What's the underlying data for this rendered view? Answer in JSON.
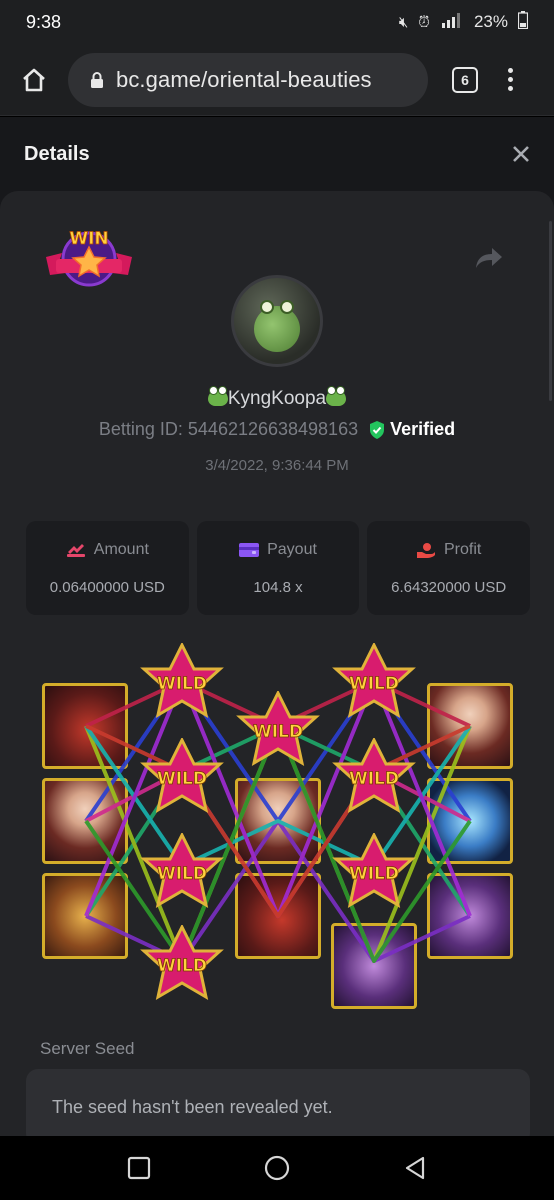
{
  "status_bar": {
    "time": "9:38",
    "battery": "23%"
  },
  "browser": {
    "url": "bc.game/oriental-beauties",
    "tab_count": "6"
  },
  "details": {
    "title": "Details",
    "badge_text": "WIN",
    "username": "KyngKoopa",
    "betting_id_label": "Betting ID:",
    "betting_id": "54462126638498163",
    "verified_label": "Verified",
    "timestamp": "3/4/2022, 9:36:44 PM"
  },
  "stats": [
    {
      "label": "Amount",
      "value": "0.06400000 USD",
      "icon": "amount-icon",
      "color": "#e5466a"
    },
    {
      "label": "Payout",
      "value": "104.8 x",
      "icon": "wallet-icon",
      "color": "#8b56f4"
    },
    {
      "label": "Profit",
      "value": "6.64320000 USD",
      "icon": "profit-icon",
      "color": "#e94a45"
    }
  ],
  "slot": {
    "wild_label": "WILD",
    "reels": [
      [
        "scroll",
        "lady",
        "comb"
      ],
      [
        "wild",
        "wild",
        "wild",
        "wild"
      ],
      [
        "wild",
        "lady",
        "scroll"
      ],
      [
        "wild",
        "wild",
        "wild",
        "fan"
      ],
      [
        "lady",
        "lotus",
        "fan"
      ]
    ]
  },
  "server_seed": {
    "label": "Server Seed",
    "message": "The seed hasn't been revealed yet."
  },
  "colors": {
    "accent_green": "#23c55e",
    "gold": "#d4ad2a",
    "page_bg": "#17181b",
    "card_bg": "#232427"
  }
}
